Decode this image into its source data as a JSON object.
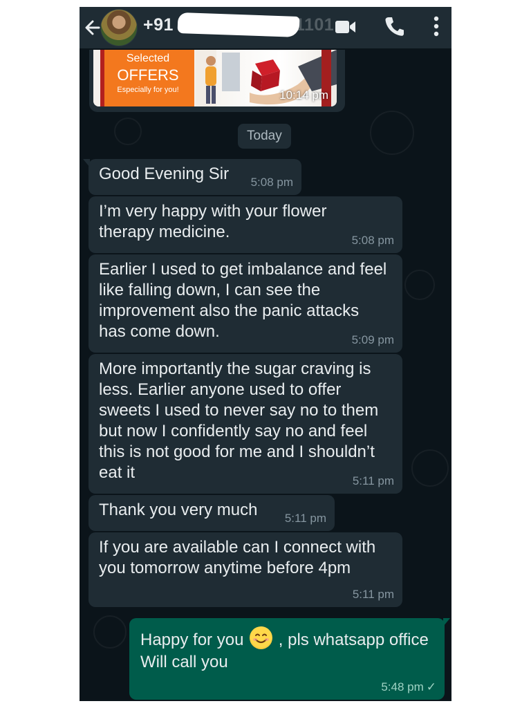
{
  "header": {
    "contact_name_visible": "+91",
    "contact_name_tail": "1101",
    "icons": [
      "back-arrow-icon",
      "video-call-icon",
      "phone-call-icon",
      "more-vert-icon"
    ]
  },
  "promo": {
    "line1": "Selected",
    "line2": "OFFERS",
    "line3": "Especially for you!",
    "time": "10:14 pm"
  },
  "date_chip": "Today",
  "messages": [
    {
      "text": "Good Evening Sir",
      "time": "5:08 pm",
      "direction": "in"
    },
    {
      "text": "I’m very happy with your flower therapy medicine.",
      "time": "5:08 pm",
      "direction": "in"
    },
    {
      "text": "Earlier I used to get imbalance and feel like falling down, I can see the improvement also the panic attacks has come down.",
      "time": "5:09 pm",
      "direction": "in"
    },
    {
      "text": "More importantly the sugar craving is less. Earlier anyone used to offer sweets I used to never say no to them but now I confidently say no and feel this is not good for me and I shouldn’t eat it",
      "time": "5:11 pm",
      "direction": "in"
    },
    {
      "text": "Thank you very much",
      "time": "5:11 pm",
      "direction": "in"
    },
    {
      "text": "If you are available can I connect with you tomorrow anytime before 4pm",
      "time": "5:11 pm",
      "direction": "in"
    }
  ],
  "outgoing": {
    "before_emoji": "Happy for you",
    "emoji": "smiling-face-icon",
    "after_emoji": ", pls whatsapp office",
    "line2": "Will call you",
    "time": "5:48 pm",
    "status": "✓"
  },
  "colors": {
    "background": "#0b141a",
    "incoming_bubble": "#1f2c34",
    "outgoing_bubble": "#005c4b",
    "header": "#1f2c34"
  }
}
